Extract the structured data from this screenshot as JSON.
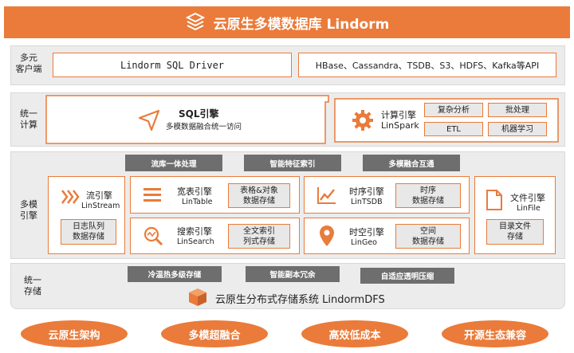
{
  "header": {
    "title": "云原生多模数据库 Lindorm"
  },
  "client_layer": {
    "label": "多元\n客户端",
    "sql_driver": "Lindorm SQL Driver",
    "api": "HBase、Cassandra、TSDB、S3、HDFS、Kafka等API"
  },
  "compute_layer": {
    "label": "统一\n计算",
    "sql_engine": {
      "name": "SQL引擎",
      "desc": "多模数据融合统一访问"
    },
    "compute_engine": {
      "name": "计算引擎",
      "sub": "LinSpark"
    },
    "tags": [
      "复杂分析",
      "批处理",
      "ETL",
      "机器学习"
    ]
  },
  "engine_layer": {
    "label": "多模\n引擎",
    "features": [
      "流库一体处理",
      "智能特征索引",
      "多模融合互通"
    ],
    "stream": {
      "name": "流引擎",
      "sub": "LinStream",
      "tag": "日志队列\n数据存储"
    },
    "table": {
      "name": "宽表引擎",
      "sub": "LinTable",
      "tag": "表格&对象\n数据存储"
    },
    "search": {
      "name": "搜索引擎",
      "sub": "LinSearch",
      "tag": "全文索引\n列式存储"
    },
    "tsdb": {
      "name": "时序引擎",
      "sub": "LinTSDB",
      "tag": "时序\n数据存储"
    },
    "geo": {
      "name": "时空引擎",
      "sub": "LinGeo",
      "tag": "空间\n数据存储"
    },
    "file": {
      "name": "文件引擎",
      "sub": "LinFile",
      "tag": "目录文件\n存储"
    }
  },
  "storage_layer": {
    "label": "统一\n存储",
    "features": [
      "冷温热多级存储",
      "智能副本冗余",
      "自适应透明压缩"
    ],
    "system": "云原生分布式存储系统 LindormDFS"
  },
  "pillars": [
    "云原生架构",
    "多模超融合",
    "高效低成本",
    "开源生态兼容"
  ],
  "colors": {
    "accent": "#ea7b3a",
    "gray": "#6e6e6e",
    "panel": "#ececec"
  }
}
